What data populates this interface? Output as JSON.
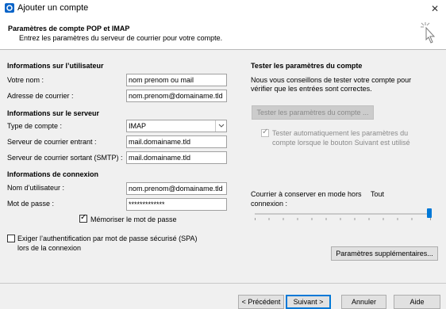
{
  "window": {
    "title": "Ajouter un compte",
    "close": "✕"
  },
  "header": {
    "title": "Paramètres de compte POP et IMAP",
    "subtitle": "Entrez les paramètres du serveur de courrier pour votre compte."
  },
  "user_info": {
    "section": "Informations sur l’utilisateur",
    "name_label": "Votre nom :",
    "name_value": "nom prenom ou mail",
    "email_label": "Adresse de courrier :",
    "email_value": "nom.prenom@domainame.tld"
  },
  "server_info": {
    "section": "Informations sur le serveur",
    "account_type_label": "Type de compte :",
    "account_type_value": "IMAP",
    "incoming_label": "Serveur de courrier entrant :",
    "incoming_value": "mail.domainame.tld",
    "outgoing_label": "Serveur de courrier sortant (SMTP) :",
    "outgoing_value": "mail.domainame.tld"
  },
  "login_info": {
    "section": "Informations de connexion",
    "username_label": "Nom d’utilisateur :",
    "username_value": "nom.prenom@domainame.tld",
    "password_label": "Mot de passe :",
    "password_value": "*************",
    "remember_label": "Mémoriser le mot de passe",
    "remember_checked": true
  },
  "spa": {
    "line1": "Exiger l’authentification par mot de passe sécurisé (SPA)",
    "line2": "lors de la connexion",
    "checked": false
  },
  "test": {
    "section": "Tester les paramètres du compte",
    "desc_line1": "Nous vous conseillons de tester votre compte pour",
    "desc_line2": "vérifier que les entrées sont correctes.",
    "test_button": "Tester les paramètres du compte ...",
    "auto_test_line1": "Tester automatiquement les paramètres du",
    "auto_test_line2": "compte lorsque le bouton Suivant est utilisé",
    "auto_test_checked": true
  },
  "offline": {
    "label_line1": "Courrier à conserver en mode hors",
    "label_value": "Tout",
    "label_line2": "connexion :",
    "slider_fraction": 1.0
  },
  "more_settings_button": "Paramètres supplémentaires...",
  "footer": {
    "back": "< Précédent",
    "next": "Suivant >",
    "cancel": "Annuler",
    "help": "Aide"
  },
  "colors": {
    "accent": "#0078d7",
    "background": "#f0f0f0"
  }
}
